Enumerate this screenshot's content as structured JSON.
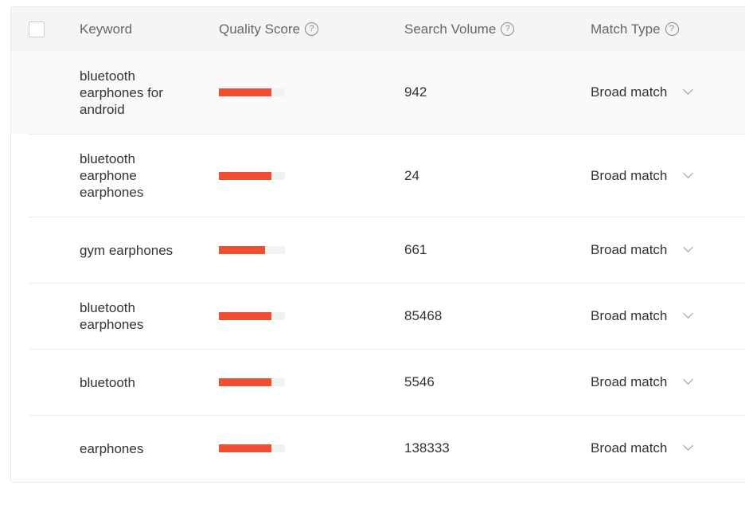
{
  "table": {
    "headers": {
      "keyword": "Keyword",
      "quality_score": "Quality Score",
      "search_volume": "Search Volume",
      "match_type": "Match Type",
      "help_glyph": "?"
    },
    "accent_color": "#f04e30",
    "rows": [
      {
        "keyword": "bluetooth earphones for android",
        "quality_score_pct": 80,
        "search_volume": "942",
        "match_type": "Broad match"
      },
      {
        "keyword": "bluetooth earphone earphones",
        "quality_score_pct": 80,
        "search_volume": "24",
        "match_type": "Broad match"
      },
      {
        "keyword": "gym earphones",
        "quality_score_pct": 70,
        "search_volume": "661",
        "match_type": "Broad match"
      },
      {
        "keyword": "bluetooth earphones",
        "quality_score_pct": 80,
        "search_volume": "85468",
        "match_type": "Broad match"
      },
      {
        "keyword": "bluetooth",
        "quality_score_pct": 80,
        "search_volume": "5546",
        "match_type": "Broad match"
      },
      {
        "keyword": "earphones",
        "quality_score_pct": 80,
        "search_volume": "138333",
        "match_type": "Broad match"
      }
    ]
  }
}
